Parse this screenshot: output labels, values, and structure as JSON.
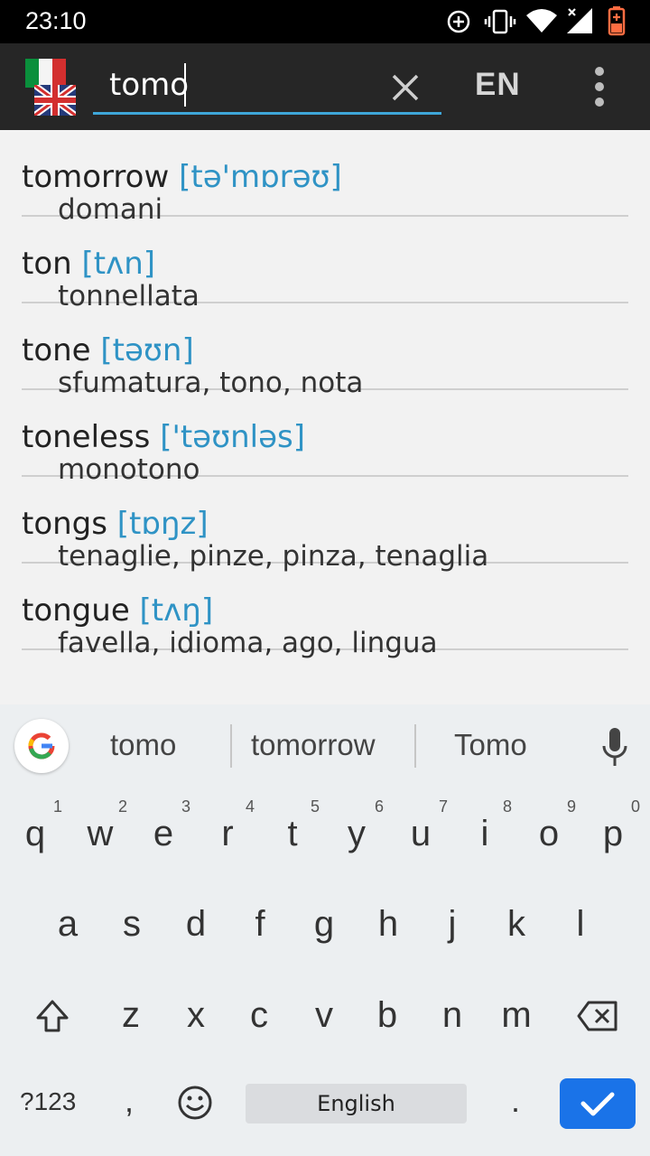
{
  "status_bar": {
    "time": "23:10"
  },
  "app_bar": {
    "search_value": "tomo",
    "language_label": "EN"
  },
  "results": [
    {
      "word": "tomorrow",
      "pronunciation": "[tə'mɒrəʊ]",
      "translation": "domani"
    },
    {
      "word": "ton",
      "pronunciation": "[tʌn]",
      "translation": "tonnellata"
    },
    {
      "word": "tone",
      "pronunciation": "[təʊn]",
      "translation": "sfumatura, tono, nota"
    },
    {
      "word": "toneless",
      "pronunciation": "['təʊnləs]",
      "translation": "monotono"
    },
    {
      "word": "tongs",
      "pronunciation": "[tɒŋz]",
      "translation": "tenaglie, pinze, pinza, tenaglia"
    },
    {
      "word": "tongue",
      "pronunciation": "[tʌŋ]",
      "translation": "favella, idioma, ago, lingua"
    }
  ],
  "keyboard": {
    "suggestions": [
      "tomo",
      "tomorrow",
      "Tomo"
    ],
    "row1": [
      {
        "k": "q",
        "h": "1"
      },
      {
        "k": "w",
        "h": "2"
      },
      {
        "k": "e",
        "h": "3"
      },
      {
        "k": "r",
        "h": "4"
      },
      {
        "k": "t",
        "h": "5"
      },
      {
        "k": "y",
        "h": "6"
      },
      {
        "k": "u",
        "h": "7"
      },
      {
        "k": "i",
        "h": "8"
      },
      {
        "k": "o",
        "h": "9"
      },
      {
        "k": "p",
        "h": "0"
      }
    ],
    "row2": [
      "a",
      "s",
      "d",
      "f",
      "g",
      "h",
      "j",
      "k",
      "l"
    ],
    "row3": [
      "z",
      "x",
      "c",
      "v",
      "b",
      "n",
      "m"
    ],
    "symbols_label": "?123",
    "comma_label": ",",
    "space_label": "English",
    "period_label": ".",
    "accent_color": "#1a73e8"
  },
  "colors": {
    "pronunciation": "#2f93c5",
    "search_underline": "#3ea6d8",
    "app_bar": "#262626"
  }
}
